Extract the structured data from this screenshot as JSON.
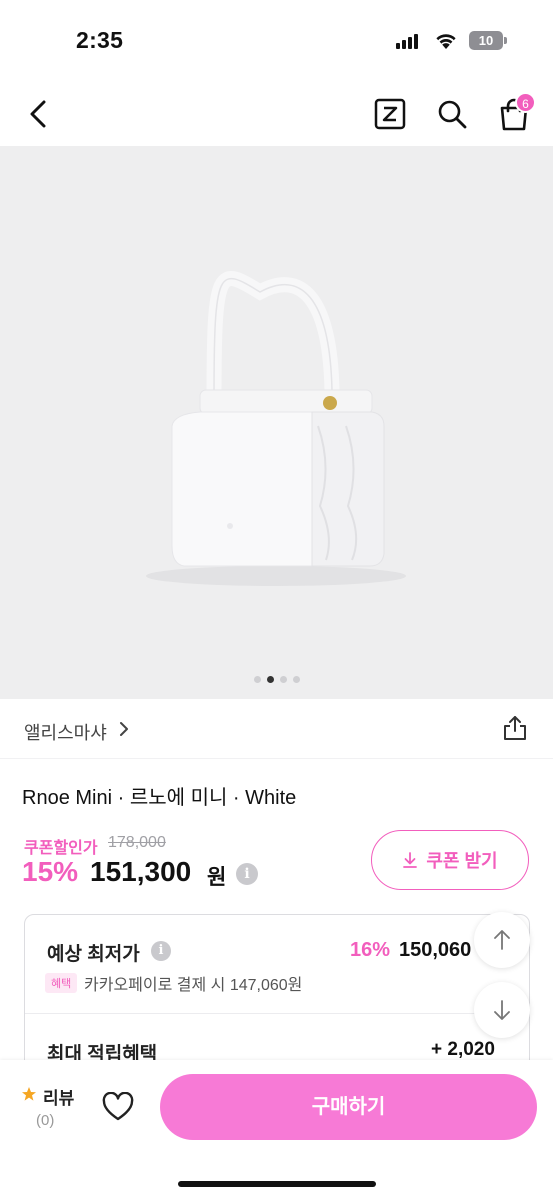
{
  "status_bar": {
    "time": "2:35",
    "battery": "10"
  },
  "nav": {
    "back_icon": "chevron-left-icon",
    "z_icon": "z-box-icon",
    "search_icon": "search-icon",
    "cart_icon": "shopping-bag-icon",
    "cart_badge": "6"
  },
  "gallery": {
    "image_alt": "white mini handbag",
    "page_count": 4,
    "active_index": 1
  },
  "brand": {
    "name": "앨리스마샤",
    "share_icon": "share-icon"
  },
  "product": {
    "title": "Rnoe Mini · 르노에 미니 · White"
  },
  "price": {
    "coupon_label": "쿠폰할인가",
    "original_price": "178,000",
    "discount_rate": "15%",
    "sale_price": "151,300",
    "currency_unit": "원",
    "coupon_button_label": "쿠폰 받기"
  },
  "benefits": {
    "lowest_label": "예상 최저가",
    "lowest_rate": "16%",
    "lowest_price": "150,060",
    "tag": "혜택",
    "kakao_text": "카카오페이로 결제 시 147,060원",
    "points_label": "최대 적립혜택",
    "points_value": "+ 2,020"
  },
  "bottom_bar": {
    "review_label": "리뷰",
    "review_count": "(0)",
    "buy_label": "구매하기"
  },
  "colors": {
    "accent": "#f25ebd",
    "buy_button": "#f77ad6"
  }
}
